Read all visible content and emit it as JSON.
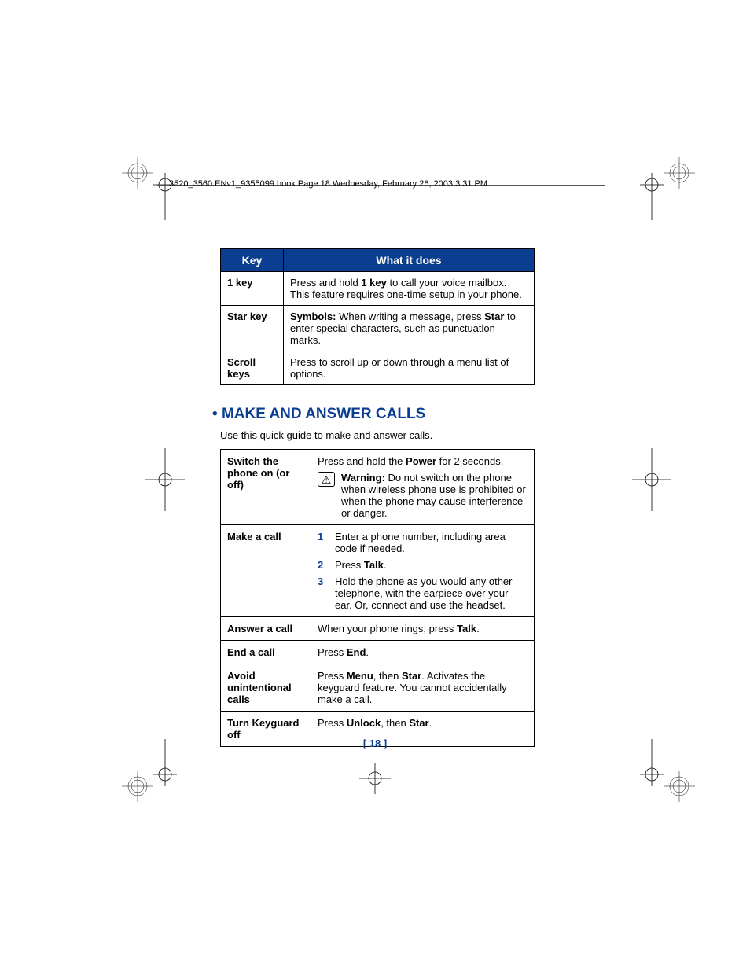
{
  "header": {
    "text": "3520_3560.ENv1_9355099.book  Page 18  Wednesday, February 26, 2003  3:31 PM"
  },
  "table1": {
    "headers": {
      "key": "Key",
      "what": "What it does"
    },
    "rows": [
      {
        "key": "1 key",
        "desc_pre": "Press and hold ",
        "desc_bold": "1 key",
        "desc_post": " to call your voice mailbox. This feature requires one-time setup in your phone."
      },
      {
        "key": "Star key",
        "desc_bold1": "Symbols:",
        "desc_mid": " When writing a message, press ",
        "desc_bold2": "Star",
        "desc_post": " to enter special characters, such as punctuation marks."
      },
      {
        "key": "Scroll keys",
        "desc": "Press to scroll up or down through a menu list of options."
      }
    ]
  },
  "section": {
    "bullet": "•",
    "title": "MAKE AND ANSWER CALLS",
    "intro": "Use this quick guide to make and answer calls."
  },
  "table2": {
    "rows": {
      "switch": {
        "label": "Switch the phone on (or off)",
        "line1_pre": "Press and hold the ",
        "line1_bold": "Power",
        "line1_post": " for 2 seconds.",
        "warning_label": "Warning:",
        "warning_text": " Do not switch on the phone when wireless phone use is prohibited or when the phone may cause interference or danger."
      },
      "make": {
        "label": "Make a call",
        "step1": "Enter a phone number, including area code if needed.",
        "step2_pre": "Press ",
        "step2_bold": "Talk",
        "step2_post": ".",
        "step3": "Hold the phone as you would any other telephone, with the earpiece over your ear. Or, connect and use the headset."
      },
      "answer": {
        "label": "Answer a call",
        "pre": "When your phone rings, press ",
        "bold": "Talk",
        "post": "."
      },
      "end": {
        "label": "End a call",
        "pre": "Press ",
        "bold": "End",
        "post": "."
      },
      "avoid": {
        "label": "Avoid unintentional calls",
        "pre": "Press ",
        "bold1": "Menu",
        "mid": ", then ",
        "bold2": "Star",
        "post": ". Activates the keyguard feature. You cannot accidentally make a call."
      },
      "keyguard": {
        "label": "Turn Keyguard off",
        "pre": "Press ",
        "bold1": "Unlock",
        "mid": ", then ",
        "bold2": "Star",
        "post": "."
      }
    }
  },
  "page_number": "[ 18 ]",
  "warning_glyph": "⚠"
}
